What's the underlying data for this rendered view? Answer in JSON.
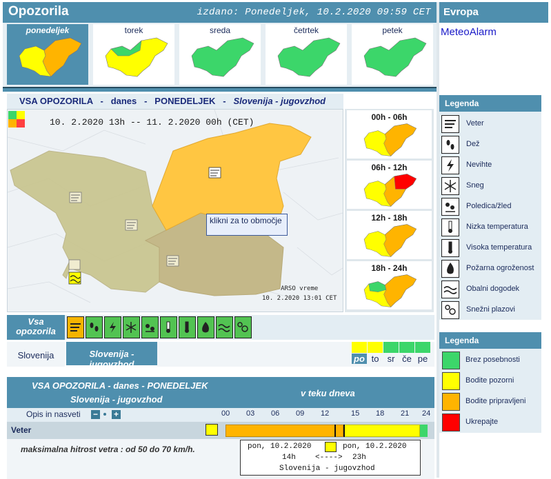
{
  "header": {
    "title": "Opozorila",
    "issued": "izdano: Ponedeljek, 10.2.2020 09:59 CET",
    "right_title": "Evropa",
    "meteoalarm": "MeteoAlarm"
  },
  "days": [
    {
      "label": "ponedeljek",
      "active": true
    },
    {
      "label": "torek",
      "active": false
    },
    {
      "label": "sreda",
      "active": false
    },
    {
      "label": "četrtek",
      "active": false
    },
    {
      "label": "petek",
      "active": false
    }
  ],
  "section": {
    "part1": "VSA OPOZORILA",
    "sep": "-",
    "part2": "danes",
    "part3": "PONEDELJEK",
    "part4": "Slovenija - jugovzhod"
  },
  "map": {
    "time_range": "10. 2.2020 13h -- 11. 2.2020 00h    (CET)",
    "tooltip": "klikni za to območje",
    "source": "ARSO vreme",
    "source_time": "10. 2.2020  13:01 CET"
  },
  "slots": [
    {
      "label": "00h - 06h"
    },
    {
      "label": "06h - 12h"
    },
    {
      "label": "12h - 18h"
    },
    {
      "label": "18h - 24h"
    }
  ],
  "icon_strip": {
    "all_label": "Vsa opozorila",
    "icons": [
      "wind-icon",
      "rain-icon",
      "thunder-icon",
      "snow-icon",
      "ice-icon",
      "low-temp-icon",
      "high-temp-icon",
      "fire-icon",
      "coastal-icon",
      "avalanche-icon"
    ]
  },
  "regions": {
    "slovenija": "Slovenija",
    "selected": "Slovenija - jugovzhod"
  },
  "day_abbr": [
    {
      "label": "po",
      "selected": true,
      "color": "#ffff00"
    },
    {
      "label": "to",
      "selected": false,
      "color": "#ffff00"
    },
    {
      "label": "sr",
      "selected": false,
      "color": "#3cd66a"
    },
    {
      "label": "če",
      "selected": false,
      "color": "#3cd66a"
    },
    {
      "label": "pe",
      "selected": false,
      "color": "#3cd66a"
    }
  ],
  "table": {
    "title1": "VSA OPOZORILA - danes - PONEDELJEK",
    "title2": "Slovenija - jugovzhod",
    "right_title": "v teku dneva",
    "opis": "Opis in nasveti",
    "hours": [
      "00",
      "03",
      "06",
      "09",
      "12",
      "15",
      "18",
      "21",
      "24"
    ],
    "row_label": "Veter",
    "detail": "maksimalna hitrost vetra : od 50 do 70 km/h.",
    "popup": {
      "from_date": "pon, 10.2.2020",
      "to_date": "pon, 10.2.2020",
      "from_hour": "14h",
      "arrow": "<---->",
      "to_hour": "23h",
      "region": "Slovenija - jugovzhod"
    }
  },
  "legend": {
    "title": "Legenda",
    "items": [
      {
        "icon": "wind-icon",
        "label": "Veter"
      },
      {
        "icon": "rain-icon",
        "label": "Dež"
      },
      {
        "icon": "thunder-icon",
        "label": "Nevihte"
      },
      {
        "icon": "snow-icon",
        "label": "Sneg"
      },
      {
        "icon": "ice-icon",
        "label": "Poledica/žled"
      },
      {
        "icon": "low-temp-icon",
        "label": "Nizka temperatura"
      },
      {
        "icon": "high-temp-icon",
        "label": "Visoka temperatura"
      },
      {
        "icon": "fire-icon",
        "label": "Požarna ogroženost"
      },
      {
        "icon": "coastal-icon",
        "label": "Obalni dogodek"
      },
      {
        "icon": "avalanche-icon",
        "label": "Snežni plazovi"
      }
    ]
  },
  "legend2": {
    "title": "Legenda",
    "items": [
      {
        "color": "#3cd66a",
        "label": "Brez posebnosti"
      },
      {
        "color": "#ffff00",
        "label": "Bodite pozorni"
      },
      {
        "color": "#ffb400",
        "label": "Bodite pripravljeni"
      },
      {
        "color": "#ff0000",
        "label": "Ukrepajte"
      }
    ]
  },
  "colors": {
    "header": "#4f8fae",
    "green": "#3cd66a",
    "yellow": "#ffff00",
    "orange": "#ffb400",
    "red": "#ff0000"
  }
}
